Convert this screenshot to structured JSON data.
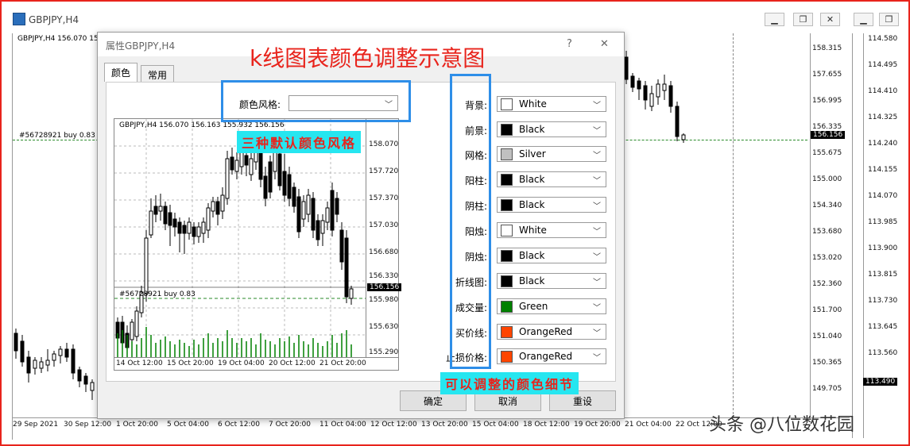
{
  "window": {
    "title": "GBPJPY,H4"
  },
  "main_chart": {
    "header": "GBPJPY,H4  156.070 15",
    "trade_label": "#56728921 buy 0.83",
    "price_labels": [
      "158.315",
      "157.655",
      "156.995",
      "156.335",
      "155.675",
      "155.000",
      "154.340",
      "153.680",
      "153.020",
      "152.360",
      "151.700",
      "151.040",
      "150.365",
      "149.705"
    ],
    "current_price": "156.156",
    "right_labels": [
      "114.580",
      "114.495",
      "114.410",
      "114.325",
      "114.240",
      "114.155",
      "114.070",
      "113.985",
      "113.900",
      "113.815",
      "113.730",
      "113.645",
      "113.560"
    ],
    "right_current": "113.490",
    "x_labels": [
      "29 Sep 2021",
      "30 Sep 12:00",
      "1 Oct 20:00",
      "5 Oct 04:00",
      "6 Oct 12:00",
      "7 Oct 20:00",
      "11 Oct 04:00",
      "12 Oct 12:00",
      "13 Oct 20:00",
      "15 Oct 04:00",
      "18 Oct 12:00",
      "19 Oct 20:00",
      "21 Oct 04:00",
      "22 Oct 12:00"
    ]
  },
  "dialog": {
    "title": "属性GBPJPY,H4",
    "help": "?",
    "close": "✕",
    "tabs": [
      {
        "label": "颜色"
      },
      {
        "label": "常用"
      }
    ],
    "scheme_label": "颜色风格:",
    "scheme_value": "",
    "preview": {
      "header": "GBPJPY,H4  156.070 156.163 155.932 156.156",
      "prices": [
        "157.720",
        "157.370",
        "157.030",
        "156.680",
        "156.330",
        "155.980",
        "155.630",
        "155.290"
      ],
      "top_price": "158.070",
      "current": "156.156",
      "trade_label": "#56728921 buy 0.83",
      "x_labels": [
        "14 Oct 12:00",
        "15 Oct 20:00",
        "19 Oct 04:00",
        "20 Oct 12:00",
        "21 Oct 20:00"
      ]
    },
    "color_rows": [
      {
        "label": "背景:",
        "value": "White",
        "color": "#ffffff"
      },
      {
        "label": "前景:",
        "value": "Black",
        "color": "#000000"
      },
      {
        "label": "网格:",
        "value": "Silver",
        "color": "#c0c0c0"
      },
      {
        "label": "阳柱:",
        "value": "Black",
        "color": "#000000"
      },
      {
        "label": "阴柱:",
        "value": "Black",
        "color": "#000000"
      },
      {
        "label": "阳烛:",
        "value": "White",
        "color": "#ffffff"
      },
      {
        "label": "阴烛:",
        "value": "Black",
        "color": "#000000"
      },
      {
        "label": "折线图:",
        "value": "Black",
        "color": "#000000"
      },
      {
        "label": "成交量:",
        "value": "Green",
        "color": "#008000"
      },
      {
        "label": "买价线:",
        "value": "OrangeRed",
        "color": "#ff4500"
      },
      {
        "label": "止损价格:",
        "value": "OrangeRed",
        "color": "#ff4500"
      }
    ],
    "buttons": {
      "ok": "确定",
      "cancel": "取消",
      "reset": "重设"
    }
  },
  "annotations": {
    "heading": "k线图表颜色调整示意图",
    "styles_note": "三种默认颜色风格",
    "details_note": "可以调整的颜色细节"
  },
  "watermark": "头条 @八位数花园"
}
